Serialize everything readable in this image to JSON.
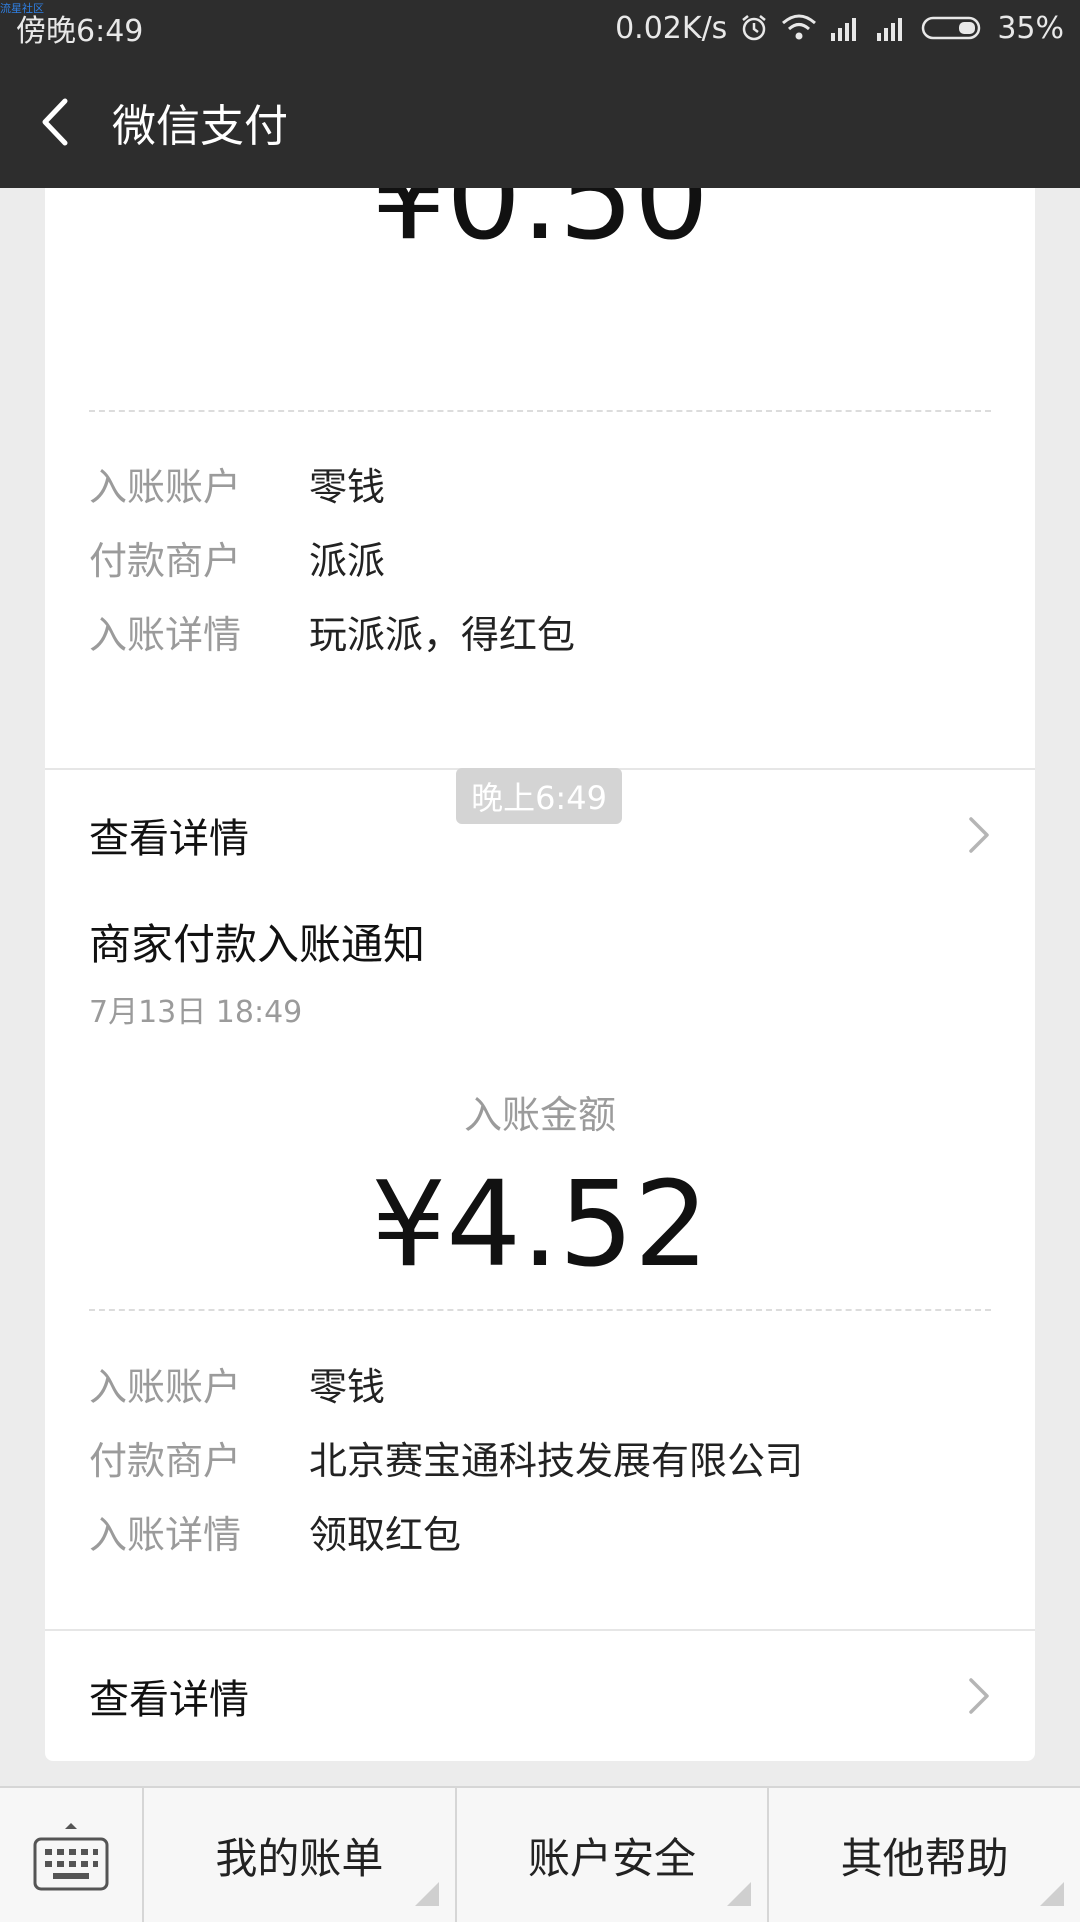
{
  "watermark": "流星社区",
  "status_bar": {
    "time": "傍晚6:49",
    "net_speed": "0.02K/s",
    "battery": "35%"
  },
  "app_bar": {
    "title": "微信支付"
  },
  "card1": {
    "amount_partial": "¥0.50",
    "rows": [
      {
        "label": "入账账户",
        "value": "零钱"
      },
      {
        "label": "付款商户",
        "value": "派派"
      },
      {
        "label": "入账详情",
        "value": "玩派派，得红包"
      }
    ],
    "link": "查看详情"
  },
  "timestamp": "晚上6:49",
  "card2": {
    "title": "商家付款入账通知",
    "date": "7月13日  18:49",
    "amount_label": "入账金额",
    "amount": "¥4.52",
    "rows": [
      {
        "label": "入账账户",
        "value": "零钱"
      },
      {
        "label": "付款商户",
        "value": "北京赛宝通科技发展有限公司"
      },
      {
        "label": "入账详情",
        "value": "领取红包"
      }
    ],
    "link": "查看详情"
  },
  "bottom_menu": {
    "items": [
      "我的账单",
      "账户安全",
      "其他帮助"
    ]
  }
}
